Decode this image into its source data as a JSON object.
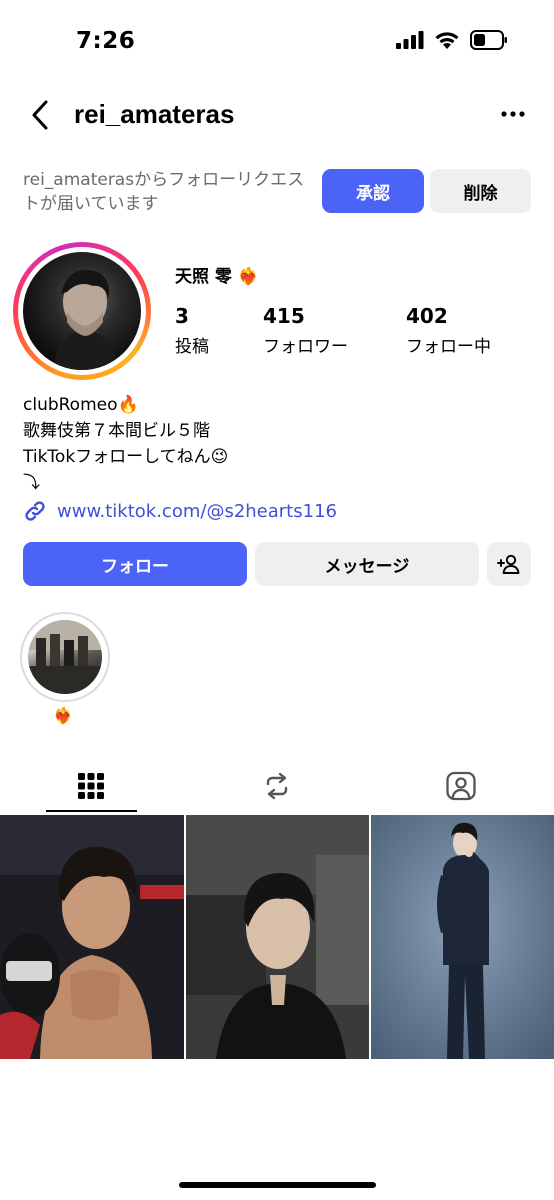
{
  "status_bar": {
    "time": "7:26"
  },
  "header": {
    "username": "rei_amateras"
  },
  "follow_request": {
    "message": "rei_amaterasからフォローリクエストが届いています",
    "approve_label": "承認",
    "delete_label": "削除"
  },
  "profile": {
    "display_name": "天照 零",
    "name_emoji": "❤️‍🔥",
    "stats": {
      "posts_count": "3",
      "posts_label": "投稿",
      "followers_count": "415",
      "followers_label": "フォロワー",
      "following_count": "402",
      "following_label": "フォロー中"
    },
    "bio": {
      "line1": "clubRomeo🔥",
      "line2": "歌舞伎第７本間ビル５階",
      "line3": "TikTokフォローしてねん😉",
      "line4": "⤵︎"
    },
    "link_text": "www.tiktok.com/@s2hearts116"
  },
  "actions": {
    "follow_label": "フォロー",
    "message_label": "メッセージ"
  },
  "highlight": {
    "label": "❤️‍🔥"
  },
  "colors": {
    "accent": "#4b63f6",
    "secondary_button": "#efeff1",
    "link": "#3f4fd8",
    "muted_text": "#6b6b6b"
  },
  "tabs": [
    {
      "icon": "grid-icon",
      "selected": true
    },
    {
      "icon": "reels-icon",
      "selected": false
    },
    {
      "icon": "tagged-icon",
      "selected": false
    }
  ]
}
